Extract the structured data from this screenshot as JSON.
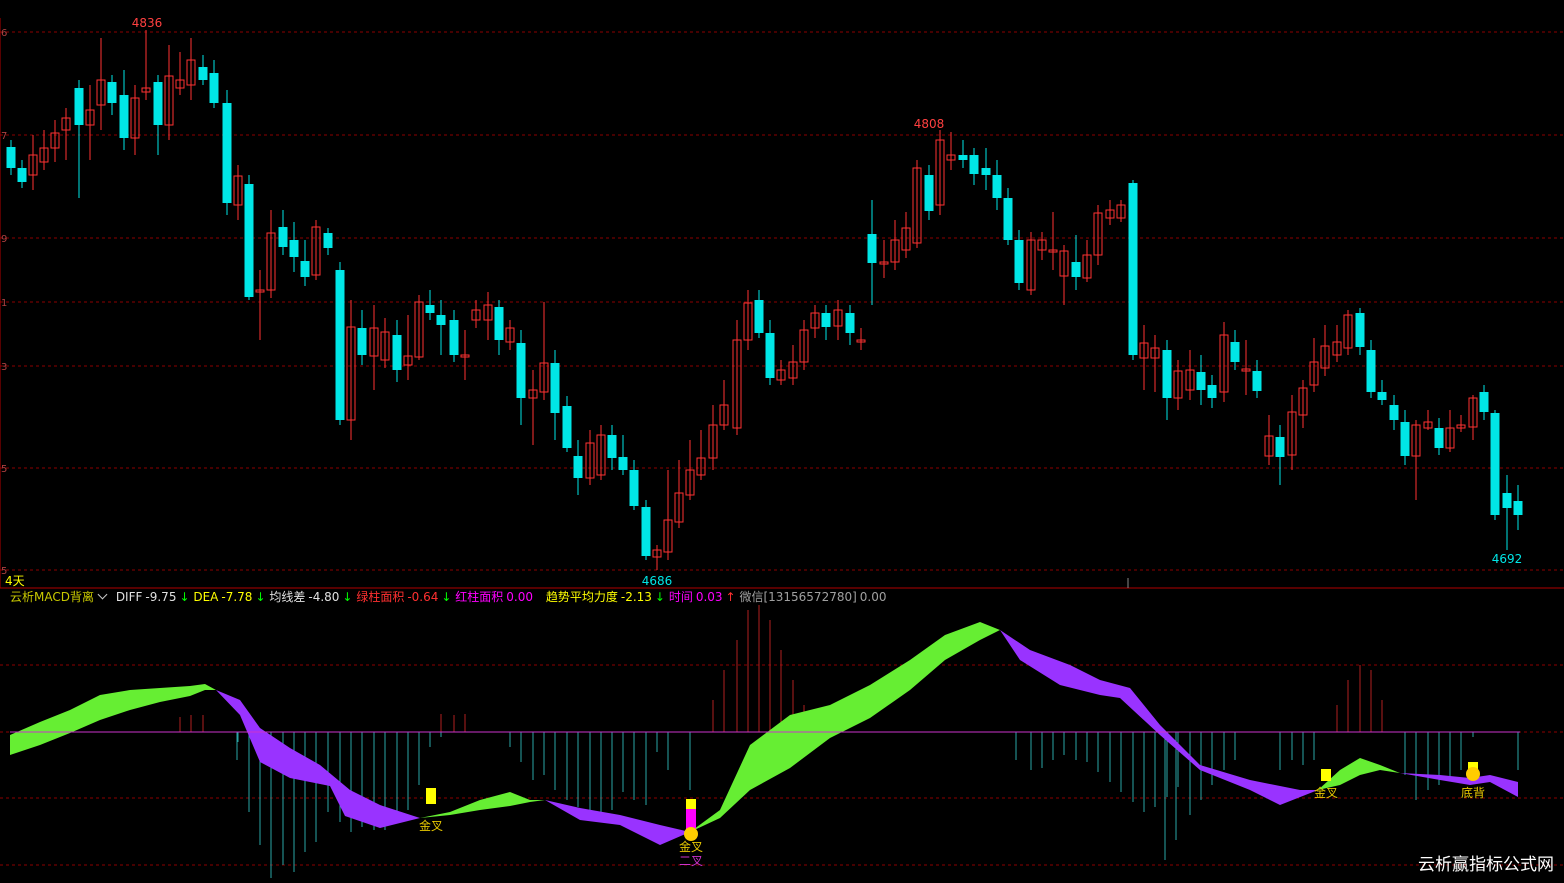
{
  "price_labels": {
    "high1": "4836",
    "high2": "4808",
    "low1": "4686",
    "low2": "4692"
  },
  "period_label": "4天",
  "indicator": {
    "name": "云析MACD背离",
    "diff_label": "DIFF",
    "diff_value": "-9.75",
    "dea_label": "DEA",
    "dea_value": "-7.78",
    "jxc_label": "均线差",
    "jxc_value": "-4.80",
    "green_area_label": "绿柱面积",
    "green_area_value": "-0.64",
    "red_area_label": "红柱面积",
    "red_area_value": "0.00",
    "trend_label": "趋势平均力度",
    "trend_value": "-2.13",
    "time_label": "时间",
    "time_value": "0.03",
    "wechat_label": "微信[13156572780]",
    "wechat_value": "0.00",
    "down_arrow": "↓",
    "up_arrow": "↑"
  },
  "signals": {
    "golden_cross": "金叉",
    "second_cross": "二叉",
    "bottom_divergence": "底背"
  },
  "colors": {
    "up": "#ff3232",
    "down": "#00e6e6",
    "grid": "#8b0000",
    "green_fill": "#66ee33",
    "purple_fill": "#9933ff",
    "yellow": "#ffff00",
    "magenta": "#ff00ff"
  },
  "watermark": "云析赢指标公式网"
}
